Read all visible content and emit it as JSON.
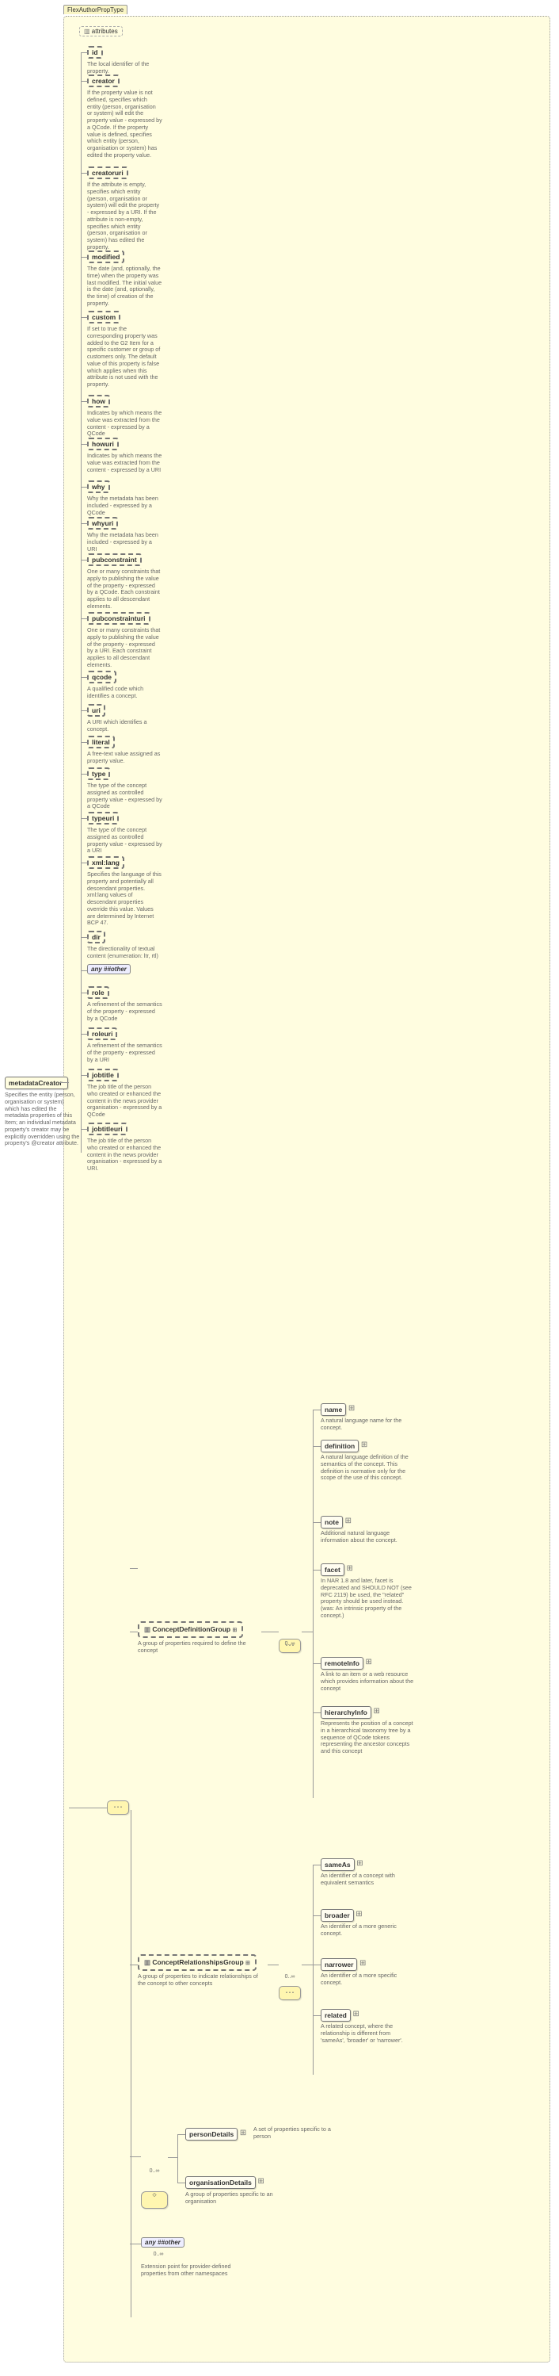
{
  "header": {
    "title": "FlexAuthorPropType"
  },
  "root": {
    "name": "metadataCreator",
    "desc": "Specifies the entity (person, organisation or system) which has edited the metadata properties of this Item; an individual metadata property's creator may be explicitly overridden using the property's @creator attribute."
  },
  "attributesLabel": "attributes",
  "any1": "any ##other",
  "any2": "any ##other",
  "attrs": [
    {
      "name": "id",
      "text": "The local identifier of the property."
    },
    {
      "name": "creator",
      "text": "If the property value is not defined, specifies which entity (person, organisation or system) will edit the property value - expressed by a QCode. If the property value is defined, specifies which entity (person, organisation or system) has edited the property value."
    },
    {
      "name": "creatoruri",
      "text": "If the attribute is empty, specifies which entity (person, organisation or system) will edit the property - expressed by a URI. If the attribute is non-empty, specifies which entity (person, organisation or system) has edited the property."
    },
    {
      "name": "modified",
      "text": "The date (and, optionally, the time) when the property was last modified. The initial value is the date (and, optionally, the time) of creation of the property."
    },
    {
      "name": "custom",
      "text": "If set to true the corresponding property was added to the G2 Item for a specific customer or group of customers only. The default value of this property is false which applies when this attribute is not used with the property."
    },
    {
      "name": "how",
      "text": "Indicates by which means the value was extracted from the content - expressed by a QCode"
    },
    {
      "name": "howuri",
      "text": "Indicates by which means the value was extracted from the content - expressed by a URI"
    },
    {
      "name": "why",
      "text": "Why the metadata has been included - expressed by a QCode"
    },
    {
      "name": "whyuri",
      "text": "Why the metadata has been included - expressed by a URI"
    },
    {
      "name": "pubconstraint",
      "text": "One or many constraints that apply to publishing the value of the property - expressed by a QCode. Each constraint applies to all descendant elements."
    },
    {
      "name": "pubconstrainturi",
      "text": "One or many constraints that apply to publishing the value of the property - expressed by a URI. Each constraint applies to all descendant elements."
    },
    {
      "name": "qcode",
      "text": "A qualified code which identifies a concept."
    },
    {
      "name": "uri",
      "text": "A URI which identifies a concept."
    },
    {
      "name": "literal",
      "text": "A free-text value assigned as property value."
    },
    {
      "name": "type",
      "text": "The type of the concept assigned as controlled property value - expressed by a QCode"
    },
    {
      "name": "typeuri",
      "text": "The type of the concept assigned as controlled property value - expressed by a URI"
    },
    {
      "name": "xml:lang",
      "text": "Specifies the language of this property and potentially all descendant properties. xml:lang values of descendant properties override this value. Values are determined by Internet BCP 47."
    },
    {
      "name": "dir",
      "text": "The directionality of textual content (enumeration: ltr, rtl)"
    },
    {
      "name": "__any1__",
      "text": ""
    },
    {
      "name": "role",
      "text": "A refinement of the semantics of the property - expressed by a QCode"
    },
    {
      "name": "roleuri",
      "text": "A refinement of the semantics of the property - expressed by a URI"
    },
    {
      "name": "jobtitle",
      "text": "The job title of the person who created or enhanced the content in the news provider organisation - expressed by a QCode"
    },
    {
      "name": "jobtitleuri",
      "text": "The job title of the person who created or enhanced the content in the news provider organisation - expressed by a URI."
    }
  ],
  "group1": {
    "name": "ConceptDefinitionGroup",
    "desc": "A group of properties required to define the concept",
    "card": "0..∞",
    "children": [
      {
        "name": "name",
        "text": "A natural language name for the concept."
      },
      {
        "name": "definition",
        "text": "A natural language definition of the semantics of the concept. This definition is normative only for the scope of the use of this concept."
      },
      {
        "name": "note",
        "text": "Additional natural language information about the concept."
      },
      {
        "name": "facet",
        "text": "In NAR 1.8 and later, facet is deprecated and SHOULD NOT (see RFC 2119) be used, the \"related\" property should be used instead. (was: An intrinsic property of the concept.)"
      },
      {
        "name": "remoteInfo",
        "text": "A link to an item or a web resource which provides information about the concept"
      },
      {
        "name": "hierarchyInfo",
        "text": "Represents the position of a concept in a hierarchical taxonomy tree by a sequence of QCode tokens representing the ancestor concepts and this concept"
      }
    ]
  },
  "group2": {
    "name": "ConceptRelationshipsGroup",
    "desc": "A group of properties to indicate relationships of the concept to other concepts",
    "card": "0..∞",
    "children": [
      {
        "name": "sameAs",
        "text": "An identifier of a concept with equivalent semantics"
      },
      {
        "name": "broader",
        "text": "An identifier of a more generic concept."
      },
      {
        "name": "narrower",
        "text": "An identifier of a more specific concept."
      },
      {
        "name": "related",
        "text": "A related concept, where the relationship is different from 'sameAs', 'broader' or 'narrower'."
      }
    ]
  },
  "choice": {
    "personDetails": {
      "name": "personDetails",
      "text": "A set of properties specific to a person"
    },
    "orgDetails": {
      "name": "organisationDetails",
      "text": "A group of properties specific to an organisation"
    },
    "card": "0..∞"
  },
  "anyExt": {
    "card": "0..∞",
    "text": "Extension point for provider-defined properties from other namespaces"
  }
}
